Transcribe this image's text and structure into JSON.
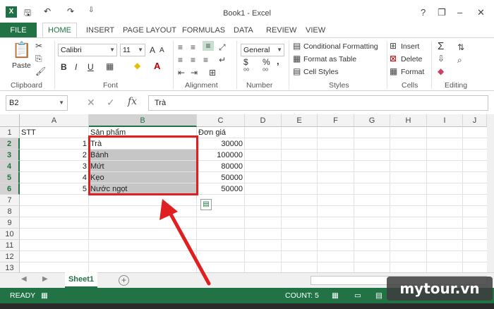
{
  "window": {
    "title": "Book1 - Excel",
    "help": "?",
    "minimize": "–",
    "restore": "❐",
    "close": "✕"
  },
  "quick_access": {
    "logo": "X",
    "save": "🖫",
    "undo": "↶",
    "redo": "↷",
    "customize": "⇩"
  },
  "tabs": {
    "file": "FILE",
    "items": [
      "HOME",
      "INSERT",
      "PAGE LAYOUT",
      "FORMULAS",
      "DATA",
      "REVIEW",
      "VIEW"
    ],
    "active": "HOME"
  },
  "ribbon": {
    "clipboard": {
      "paste": "Paste",
      "label": "Clipboard"
    },
    "font": {
      "name": "Calibri",
      "size": "11",
      "bold": "B",
      "italic": "I",
      "underline": "U",
      "grow": "A",
      "shrink": "A",
      "label": "Font"
    },
    "alignment": {
      "label": "Alignment"
    },
    "number": {
      "format": "General",
      "currency": "$",
      "percent": "%",
      "comma": ",",
      "label": "Number"
    },
    "styles": {
      "conditional": "Conditional Formatting",
      "table": "Format as Table",
      "cell_styles": "Cell Styles",
      "label": "Styles"
    },
    "cells": {
      "insert": "Insert",
      "delete": "Delete",
      "format": "Format",
      "label": "Cells"
    },
    "editing": {
      "sum": "Σ",
      "label": "Editing"
    }
  },
  "formula_bar": {
    "name_box": "B2",
    "fx": "fx",
    "value": "Trà"
  },
  "columns": [
    "A",
    "B",
    "C",
    "D",
    "E",
    "F",
    "G",
    "H",
    "I",
    "J"
  ],
  "selected_column": "B",
  "rows": [
    "1",
    "2",
    "3",
    "4",
    "5",
    "6",
    "7",
    "8",
    "9",
    "10",
    "11",
    "12",
    "13"
  ],
  "headers": {
    "a1": "STT",
    "b1": "Sản phẩm",
    "c1": "Đơn giá"
  },
  "table": [
    {
      "stt": "1",
      "product": "Trà",
      "price": "30000"
    },
    {
      "stt": "2",
      "product": "Bánh",
      "price": "100000"
    },
    {
      "stt": "3",
      "product": "Mứt",
      "price": "80000"
    },
    {
      "stt": "4",
      "product": "Kẹo",
      "price": "50000"
    },
    {
      "stt": "5",
      "product": "Nước ngọt",
      "price": "50000"
    }
  ],
  "sheets": {
    "active": "Sheet1",
    "add": "+"
  },
  "status": {
    "ready": "READY",
    "count": "COUNT: 5"
  },
  "watermark": "mytour.vn",
  "colors": {
    "accent": "#217346",
    "highlight": "#e02020"
  }
}
